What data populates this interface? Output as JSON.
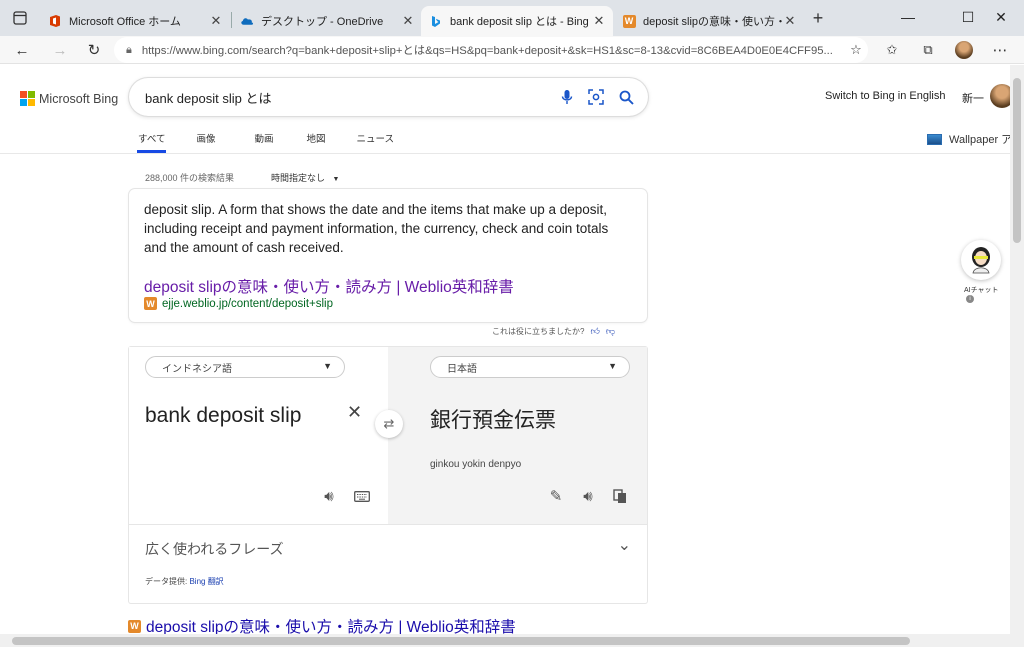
{
  "tabs": [
    {
      "title": "Microsoft Office ホーム",
      "icon": "office-icon"
    },
    {
      "title": "デスクトップ - OneDrive",
      "icon": "onedrive-icon"
    },
    {
      "title": "bank deposit slip とは - Bing",
      "icon": "bing-icon",
      "active": true
    },
    {
      "title": "deposit slipの意味・使い方・読み方",
      "icon": "weblio-icon"
    }
  ],
  "address_bar": {
    "url": "https://www.bing.com/search?q=bank+deposit+slip+とは&qs=HS&pq=bank+deposit+&sk=HS1&sc=8-13&cvid=8C6BEA4D0E0E4CFF95..."
  },
  "header": {
    "logo_text": "Microsoft Bing",
    "query": "bank deposit slip とは",
    "switch_lang": "Switch to Bing in English",
    "user_name": "新一"
  },
  "scopes": [
    "すべて",
    "画像",
    "動画",
    "地図",
    "ニュース"
  ],
  "wallpaper_label": "Wallpaper ア",
  "results_count": "288,000 件の検索結果",
  "time_filter": "時間指定なし",
  "definition": {
    "text": "deposit slip. A form that shows the date and the items that make up a deposit, including receipt and payment information, the currency, check and coin totals and the amount of cash received.",
    "link_title": "deposit slipの意味・使い方・読み方 | Weblio英和辞書",
    "link_url": "ejje.weblio.jp/content/deposit+slip"
  },
  "feedback_question": "これは役に立ちましたか?",
  "translator": {
    "source_lang": "インドネシア語",
    "target_lang": "日本語",
    "source_text": "bank deposit slip",
    "target_text": "銀行預金伝票",
    "transliteration": "ginkou yokin denpyo",
    "phrases_label": "広く使われるフレーズ",
    "provider_prefix": "データ提供: ",
    "provider_name": "Bing 翻訳"
  },
  "next_result": {
    "title": "deposit slipの意味・使い方・読み方 | Weblio英和辞書"
  },
  "ai_chat_label": "AIチャット",
  "colors": {
    "accent": "#174ae4",
    "visited_link": "#681da8",
    "link": "#1a0dab",
    "url_green": "#006621"
  }
}
